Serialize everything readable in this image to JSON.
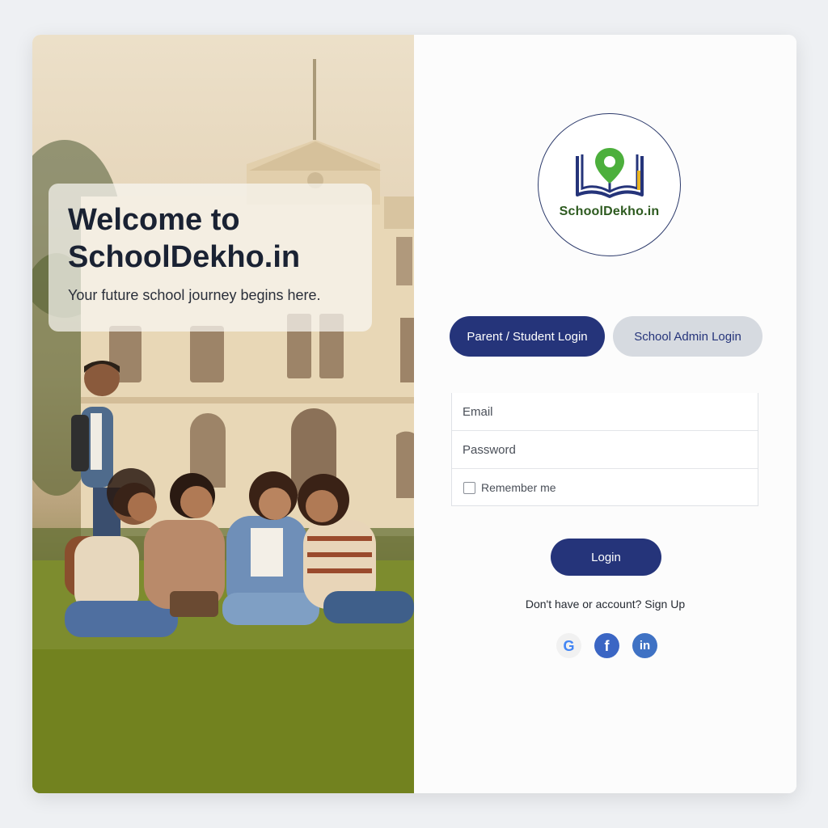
{
  "hero": {
    "title": "Welcome to\nSchoolDekho.in",
    "subtitle": "Your future school journey begins here."
  },
  "logo": {
    "text": "SchoolDekho.in",
    "icon": "book-location-pin-icon",
    "colors": {
      "book": "#25347a",
      "pin": "#4caf3c",
      "text": "#2d5a1f"
    }
  },
  "tabs": {
    "parent_label": "Parent / Student Login",
    "admin_label": "School Admin Login",
    "active": "parent"
  },
  "form": {
    "email_placeholder": "Email",
    "password_placeholder": "Password",
    "remember_label": "Remember me",
    "login_label": "Login"
  },
  "signup": {
    "text": "Don't have or account? Sign Up"
  },
  "socials": [
    {
      "name": "google-icon",
      "glyph": "G"
    },
    {
      "name": "facebook-icon",
      "glyph": "f"
    },
    {
      "name": "linkedin-icon",
      "glyph": "in"
    }
  ],
  "colors": {
    "primary": "#25347a",
    "secondary_tab": "#d6dae0",
    "background": "#eef0f3"
  }
}
